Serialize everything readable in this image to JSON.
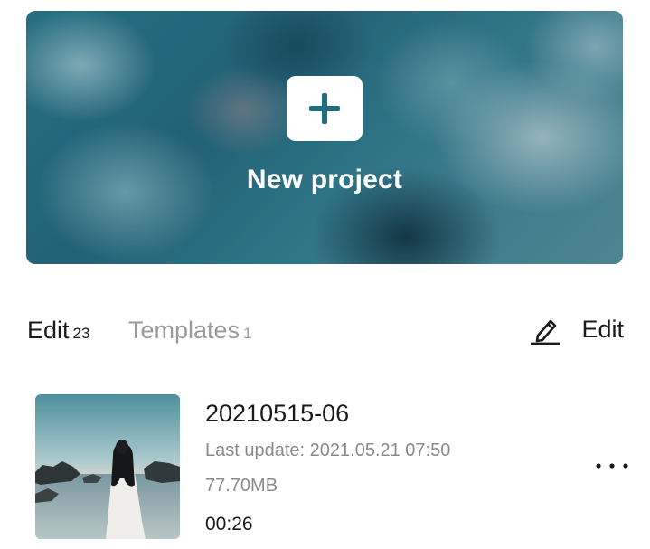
{
  "new_project": {
    "label": "New project",
    "icon": "plus-icon"
  },
  "tabs": [
    {
      "label": "Edit",
      "count": "23",
      "active": true
    },
    {
      "label": "Templates",
      "count": "1",
      "active": false
    }
  ],
  "edit_action": {
    "label": "Edit",
    "icon": "pencil-icon"
  },
  "projects": [
    {
      "name": "20210515-06",
      "last_update": "Last update: 2021.05.21 07:50",
      "size": "77.70MB",
      "duration": "00:26",
      "thumbnail": "woman-on-beach-thumbnail",
      "more_icon": "more-dots-icon"
    }
  ],
  "colors": {
    "accent": "#1f6f80",
    "text_primary": "#1a1a1a",
    "text_secondary": "#8a8a8a",
    "tab_inactive": "#9a9a9a"
  }
}
